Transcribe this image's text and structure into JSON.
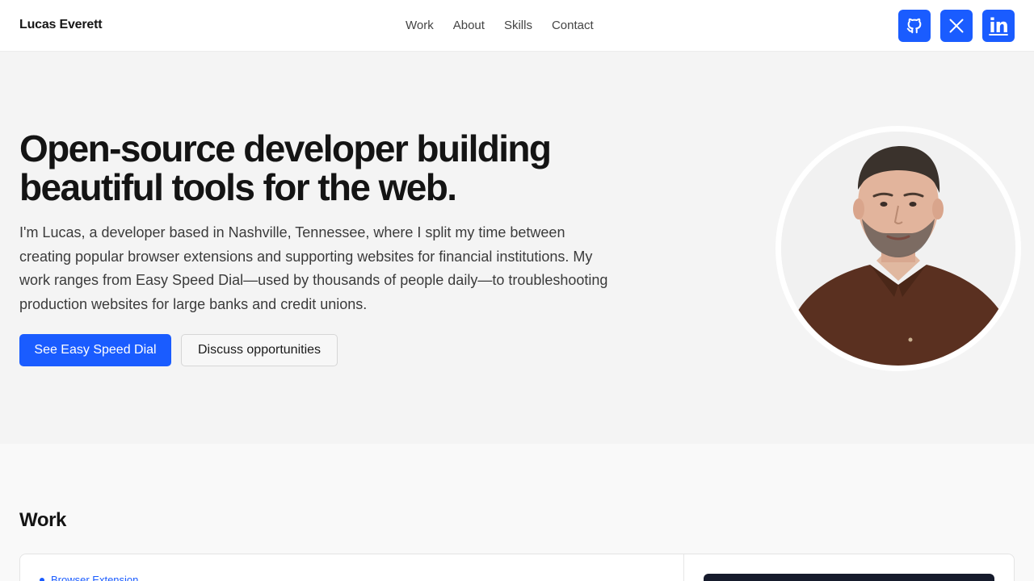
{
  "header": {
    "brand": "Lucas Everett",
    "nav": [
      "Work",
      "About",
      "Skills",
      "Contact"
    ],
    "socials": [
      {
        "name": "github",
        "icon": "github-icon"
      },
      {
        "name": "x",
        "icon": "x-icon"
      },
      {
        "name": "linkedin",
        "icon": "linkedin-icon",
        "glyph": "in"
      }
    ]
  },
  "hero": {
    "title_line1": "Open-source developer building",
    "title_line2": "beautiful tools for the web.",
    "lead": "I'm Lucas, a developer based in Nashville, Tennessee, where I split my time between creating popular browser extensions and supporting websites for financial institutions. My work ranges from Easy Speed Dial—used by thousands of people daily—to troubleshooting production websites for large banks and credit unions.",
    "primary_button": "See Easy Speed Dial",
    "secondary_button": "Discuss opportunities"
  },
  "work": {
    "title": "Work",
    "card_tag": "Browser Extension"
  },
  "colors": {
    "accent": "#1a5cff",
    "page_bg": "#f4f4f4",
    "text": "#141414"
  }
}
